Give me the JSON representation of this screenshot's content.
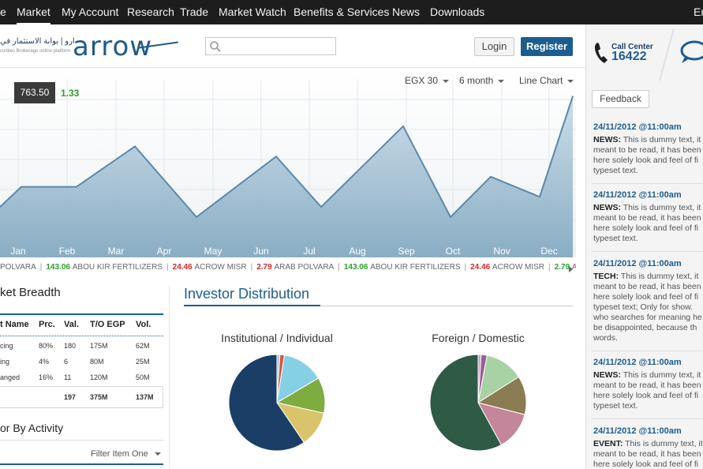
{
  "nav": {
    "items": [
      "e",
      "Market",
      "My Account",
      "Research",
      "Trade",
      "Market Watch",
      "Benefits & Services",
      "News",
      "Downloads",
      "En"
    ],
    "active": "Market"
  },
  "header": {
    "logo_arabic": "ارو | بوابة الاستثمار في",
    "logo_tagline": "curities Brokerage online platform",
    "logo_word": "arrow",
    "search_placeholder": "",
    "login_label": "Login",
    "register_label": "Register"
  },
  "chart_controls": {
    "index": "EGX 30",
    "period": "6 month",
    "type": "Line Chart"
  },
  "price": {
    "value": "763.50",
    "change": "1.33"
  },
  "chart_data": {
    "type": "area",
    "categories": [
      "Jan",
      "Feb",
      "Mar",
      "Apr",
      "May",
      "Jun",
      "Jul",
      "Aug",
      "Sep",
      "Oct",
      "Nov",
      "Dec"
    ],
    "title": "",
    "xlabel": "",
    "ylabel": "",
    "series": [
      {
        "values": [
          755,
          757,
          757,
          761,
          754,
          760,
          755,
          759,
          763,
          754,
          758,
          756,
          766
        ]
      }
    ],
    "x_points": [
      "start",
      "Jan",
      "Feb",
      "Mar",
      "Apr",
      "May",
      "Jun",
      "Jul",
      "Aug",
      "Sep",
      "Oct",
      "Nov",
      "Dec"
    ],
    "grid": true
  },
  "ticker": [
    {
      "value": "",
      "name": "POLVARA",
      "dir": "none"
    },
    {
      "value": "143.06",
      "name": "ABOU KIR FERTILIZERS",
      "dir": "up"
    },
    {
      "value": "24.46",
      "name": "ACROW MISR",
      "dir": "down"
    },
    {
      "value": "2.79",
      "name": "ARAB POLVARA",
      "dir": "down"
    },
    {
      "value": "143.06",
      "name": "ABOU KIR FERTILIZERS",
      "dir": "up"
    },
    {
      "value": "24.46",
      "name": "ACROW MISR",
      "dir": "down"
    },
    {
      "value": "2.79",
      "name": "ACROW MISR",
      "dir": "up"
    }
  ],
  "market_breadth": {
    "title": "ket Breadth",
    "headers": [
      "t Name",
      "Prc.",
      "Val.",
      "T/O EGP",
      "Vol."
    ],
    "rows": [
      [
        "cing",
        "80%",
        "180",
        "175M",
        "62M"
      ],
      [
        "ing",
        "4%",
        "6",
        "80M",
        "25M"
      ],
      [
        "anged",
        "16%",
        "11",
        "120M",
        "50M"
      ]
    ],
    "totals": [
      "197",
      "375M",
      "137M"
    ]
  },
  "investor_by_activity": {
    "title": "or By Activity",
    "filter": "Filter Item One"
  },
  "investor_distribution": {
    "title": "Investor Distribution",
    "pies": [
      {
        "title": "Institutional / Individual",
        "slices": [
          {
            "value": 1,
            "color": "#a9c9de"
          },
          {
            "value": 1.5,
            "color": "#d2553b"
          },
          {
            "value": 14,
            "color": "#86d0e6"
          },
          {
            "value": 12,
            "color": "#7fac3f"
          },
          {
            "value": 12,
            "color": "#d9c46b"
          },
          {
            "value": 59.5,
            "color": "#1a3e66"
          }
        ]
      },
      {
        "title": "Foreign / Domestic",
        "slices": [
          {
            "value": 1,
            "color": "#c6a2c6"
          },
          {
            "value": 2,
            "color": "#9a5d9a"
          },
          {
            "value": 13,
            "color": "#a9d2a4"
          },
          {
            "value": 13,
            "color": "#8b7b53"
          },
          {
            "value": 13,
            "color": "#c4869a"
          },
          {
            "value": 58,
            "color": "#2f5a45"
          }
        ]
      }
    ]
  },
  "sidebar": {
    "call_center_label": "Call Center",
    "call_center_number": "16422",
    "feedback_label": "Feedback",
    "news": [
      {
        "date": "24/11/2012  @11:00am",
        "tag": "NEWS:",
        "text": " This is dummy text, it meant to be read, it has been here solely look and feel of fi typeset text."
      },
      {
        "date": "24/11/2012  @11:00am",
        "tag": "NEWS:",
        "text": " This is dummy text, it meant to be read, it has been here solely look and feel of fi typeset text."
      },
      {
        "date": "24/11/2012  @11:00am",
        "tag": "TECH:",
        "text": " This is dummy text, it meant to be read, it has been here solely look and feel of fi typeset text; Only for show. who searches for meaning he be disappointed, because th words."
      },
      {
        "date": "24/11/2012  @11:00am",
        "tag": "NEWS:",
        "text": " This is dummy text, it meant to be read, it has been here solely look and feel of fi typeset text."
      },
      {
        "date": "24/11/2012  @11:00am",
        "tag": "EVENT:",
        "text": " This is dummy text, it meant to be read, it has been here solely look and feel of fi"
      }
    ],
    "colors": {
      "accent": "#1c5d90"
    }
  }
}
